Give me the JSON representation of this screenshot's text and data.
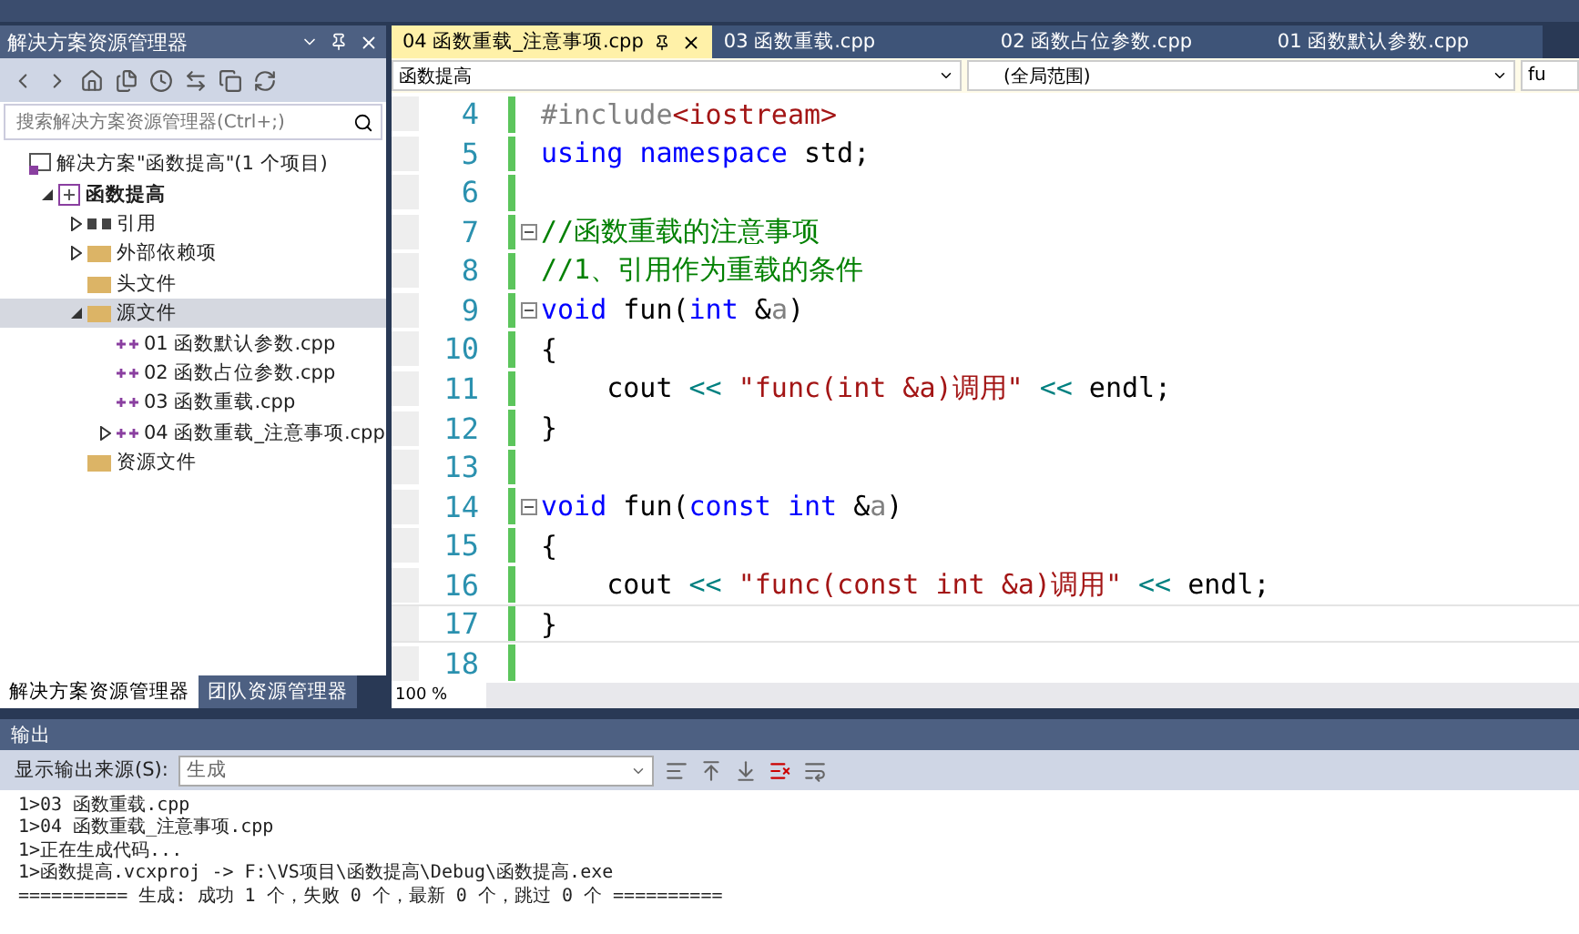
{
  "solution_explorer": {
    "title": "解决方案资源管理器",
    "search": {
      "placeholder": "搜索解决方案资源管理器(Ctrl+;)"
    },
    "tree": [
      {
        "label": "解决方案\"函数提高\"(1 个项目)",
        "kind": "solution",
        "selected": false,
        "children": [
          {
            "label": "函数提高",
            "kind": "project",
            "bold": true,
            "expanded": true,
            "selected": false,
            "children": [
              {
                "label": "引用",
                "kind": "references",
                "expanded": false,
                "selected": false
              },
              {
                "label": "外部依赖项",
                "kind": "folder",
                "expanded": false,
                "selected": false
              },
              {
                "label": "头文件",
                "kind": "folder",
                "selected": false
              },
              {
                "label": "源文件",
                "kind": "folder",
                "expanded": true,
                "selected": true,
                "children": [
                  {
                    "label": "01 函数默认参数.cpp",
                    "kind": "cpp",
                    "selected": false
                  },
                  {
                    "label": "02 函数占位参数.cpp",
                    "kind": "cpp",
                    "selected": false
                  },
                  {
                    "label": "03 函数重载.cpp",
                    "kind": "cpp",
                    "selected": false
                  },
                  {
                    "label": "04 函数重载_注意事项.cpp",
                    "kind": "cpp",
                    "expanded": false,
                    "selected": false
                  }
                ]
              },
              {
                "label": "资源文件",
                "kind": "folder",
                "selected": false
              }
            ]
          }
        ]
      }
    ],
    "bottom_tabs": [
      {
        "label": "解决方案资源管理器",
        "selected": true
      },
      {
        "label": "团队资源管理器",
        "selected": false
      }
    ]
  },
  "editor": {
    "tabs": [
      {
        "label": "04 函数重载_注意事项.cpp",
        "selected": true
      },
      {
        "label": "03 函数重载.cpp",
        "selected": false
      },
      {
        "label": "02 函数占位参数.cpp",
        "selected": false
      },
      {
        "label": "01 函数默认参数.cpp",
        "selected": false
      }
    ],
    "nav": {
      "project": "函数提高",
      "scope": "(全局范围)",
      "member": "fu"
    },
    "lines": [
      {
        "number": "4",
        "collapsible": false,
        "current": false,
        "tokens": [
          {
            "text": "#include",
            "kind": "preproc"
          },
          {
            "text": "<iostream>",
            "kind": "string"
          }
        ]
      },
      {
        "number": "5",
        "collapsible": false,
        "current": false,
        "tokens": [
          {
            "text": "using ",
            "kind": "keyword"
          },
          {
            "text": "namespace",
            "kind": "keyword"
          },
          {
            "text": " std;",
            "kind": "plain"
          }
        ]
      },
      {
        "number": "6",
        "collapsible": false,
        "current": false
      },
      {
        "number": "7",
        "collapsible": true,
        "current": false,
        "tokens": [
          {
            "text": "//函数重载的注意事项",
            "kind": "comment"
          }
        ]
      },
      {
        "number": "8",
        "collapsible": false,
        "current": false,
        "tokens": [
          {
            "text": "//1、引用作为重载的条件",
            "kind": "comment"
          }
        ]
      },
      {
        "number": "9",
        "collapsible": true,
        "current": false,
        "tokens": [
          {
            "text": "void",
            "kind": "keyword"
          },
          {
            "text": " fun(",
            "kind": "plain"
          },
          {
            "text": "int",
            "kind": "keyword"
          },
          {
            "text": " &",
            "kind": "plain"
          },
          {
            "text": "a",
            "kind": "param"
          },
          {
            "text": ")",
            "kind": "plain"
          }
        ]
      },
      {
        "number": "10",
        "collapsible": false,
        "current": false,
        "tokens": [
          {
            "text": "{",
            "kind": "plain"
          }
        ]
      },
      {
        "number": "11",
        "collapsible": false,
        "current": false,
        "tokens": [
          {
            "text": "    cout ",
            "kind": "plain"
          },
          {
            "text": "<< ",
            "kind": "operator"
          },
          {
            "text": "\"func(int &a)调用\" ",
            "kind": "string"
          },
          {
            "text": "<<",
            "kind": "operator"
          },
          {
            "text": " endl;",
            "kind": "plain"
          }
        ]
      },
      {
        "number": "12",
        "collapsible": false,
        "current": false,
        "tokens": [
          {
            "text": "}",
            "kind": "plain"
          }
        ]
      },
      {
        "number": "13",
        "collapsible": false,
        "current": false
      },
      {
        "number": "14",
        "collapsible": true,
        "current": false,
        "tokens": [
          {
            "text": "void",
            "kind": "keyword"
          },
          {
            "text": " fun(",
            "kind": "plain"
          },
          {
            "text": "const ",
            "kind": "keyword"
          },
          {
            "text": "int",
            "kind": "keyword"
          },
          {
            "text": " &",
            "kind": "plain"
          },
          {
            "text": "a",
            "kind": "param"
          },
          {
            "text": ")",
            "kind": "plain"
          }
        ]
      },
      {
        "number": "15",
        "collapsible": false,
        "current": false,
        "tokens": [
          {
            "text": "{",
            "kind": "plain"
          }
        ]
      },
      {
        "number": "16",
        "collapsible": false,
        "current": false,
        "tokens": [
          {
            "text": "    cout ",
            "kind": "plain"
          },
          {
            "text": "<< ",
            "kind": "operator"
          },
          {
            "text": "\"func(const int &a)调用\" ",
            "kind": "string"
          },
          {
            "text": "<<",
            "kind": "operator"
          },
          {
            "text": " endl;",
            "kind": "plain"
          }
        ]
      },
      {
        "number": "17",
        "collapsible": false,
        "current": true,
        "tokens": [
          {
            "text": "}",
            "kind": "plain"
          }
        ]
      },
      {
        "number": "18",
        "collapsible": false,
        "current": false
      }
    ],
    "zoom": "100 %"
  },
  "output": {
    "title": "输出",
    "source_label": "显示输出来源(S):",
    "source": "生成",
    "lines": [
      "1>03 函数重载.cpp",
      "1>04 函数重载_注意事项.cpp",
      "1>正在生成代码...",
      "1>函数提高.vcxproj -> F:\\VS项目\\函数提高\\Debug\\函数提高.exe",
      "========== 生成: 成功 1 个，失败 0 个，最新 0 个，跳过 0 个 =========="
    ]
  }
}
